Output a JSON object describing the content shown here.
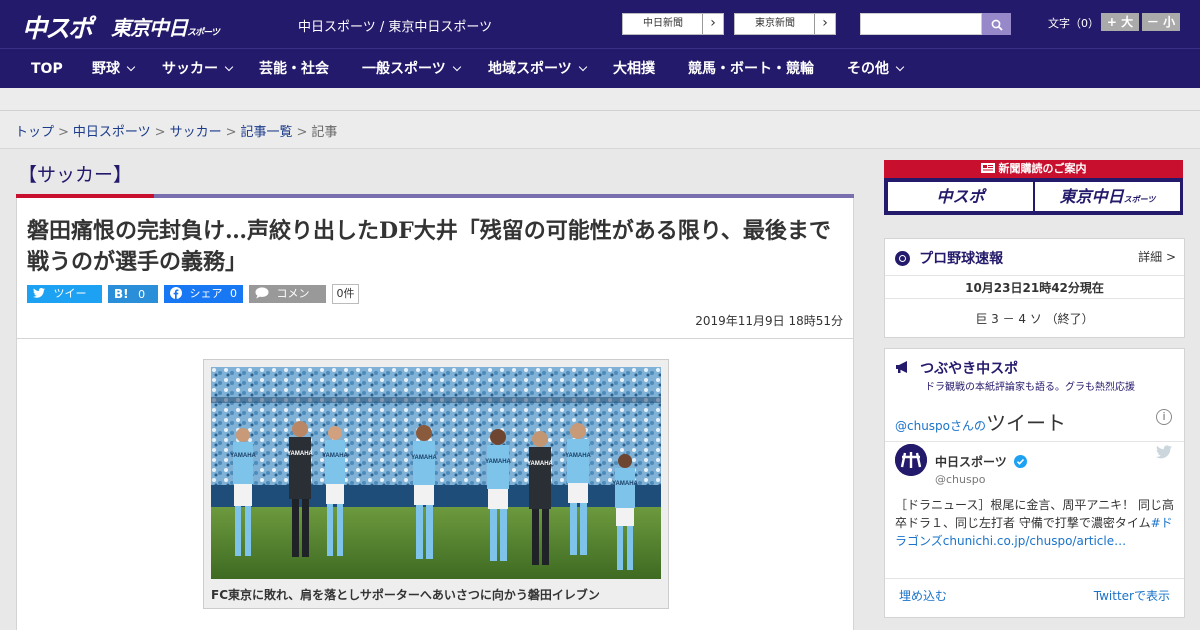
{
  "header": {
    "logo_chuspo": "中スポ",
    "logo_tokyo": "東京中日",
    "logo_tokyo_sub": "スポーツ",
    "tagline": "中日スポーツ / 東京中日スポーツ",
    "paper_links": [
      {
        "label": "中日新聞",
        "arrow": "›"
      },
      {
        "label": "東京新聞",
        "arrow": "›"
      }
    ],
    "search": {
      "placeholder": ""
    },
    "font_size_label": "文字（0）",
    "font_bigger": "+ 大",
    "font_smaller": "－ 小"
  },
  "nav": {
    "items": [
      {
        "label": "TOP",
        "dropdown": false
      },
      {
        "label": "野球",
        "dropdown": true
      },
      {
        "label": "サッカー",
        "dropdown": true
      },
      {
        "label": "芸能・社会",
        "dropdown": false
      },
      {
        "label": "一般スポーツ",
        "dropdown": true
      },
      {
        "label": "地域スポーツ",
        "dropdown": true
      },
      {
        "label": "大相撲",
        "dropdown": false
      },
      {
        "label": "競馬・ボート・競輪",
        "dropdown": false
      },
      {
        "label": "その他",
        "dropdown": true
      }
    ]
  },
  "breadcrumb": {
    "items": [
      "トップ",
      "中日スポーツ",
      "サッカー",
      "記事一覧"
    ],
    "current": "記事",
    "separator": ">"
  },
  "article": {
    "category": "【サッカー】",
    "title": "磐田痛恨の完封負け…声絞り出したDF大井「残留の可能性がある限り、最後まで戦うのが選手の義務」",
    "share": {
      "tweet": "ツイート",
      "hatena_count": "0",
      "fb_share": "シェア",
      "fb_count": "0",
      "comment": "コメント",
      "comment_count": "0件"
    },
    "date": "2019年11月9日 18時51分",
    "photo_caption": "FC東京に敗れ、肩を落としサポーターへあいさつに向かう磐田イレブン",
    "photo_jerseys": [
      "YAMAHA",
      "YAMAHA",
      "YAMAHA",
      "YAMAHA",
      "YAMAHA",
      "YAMAHA",
      "YAMAHA",
      "YAMAHA"
    ]
  },
  "sidebar": {
    "ad": {
      "top": "新聞購読のご案内",
      "left": "中スポ",
      "right": "東京中日",
      "right_sub": "スポーツ"
    },
    "baseball": {
      "title": "プロ野球速報",
      "detail": "詳細 >",
      "timestamp": "10月23日21時42分現在",
      "score": "巨 3 － 4 ソ （終了）"
    },
    "tsubuyaki": {
      "title": "つぶやき中スポ",
      "subtitle": "ドラ観戦の本紙評論家も語る。グラも熱烈応援",
      "handle_prefix": "@chuspoさんの",
      "tweets_label": "ツイート",
      "account_name": "中日スポーツ",
      "account_handle": "@chuspo",
      "tweet_text": "［ドラニュース］根尾に金言、周平アニキ！ 同じ高卒ドラ１、同じ左打者 守備で打撃で濃密タイム",
      "tweet_hashtag": "#ドラゴンズ",
      "tweet_link": "chunichi.co.jp/chuspo/article…",
      "embed": "埋め込む",
      "view_on_twitter": "Twitterで表示"
    }
  },
  "colors": {
    "brand_navy": "#241a6b",
    "accent_red": "#c8102e",
    "twitter_blue": "#1da1f2",
    "facebook_blue": "#1877f2",
    "hatena_blue": "#2a8fd8"
  }
}
